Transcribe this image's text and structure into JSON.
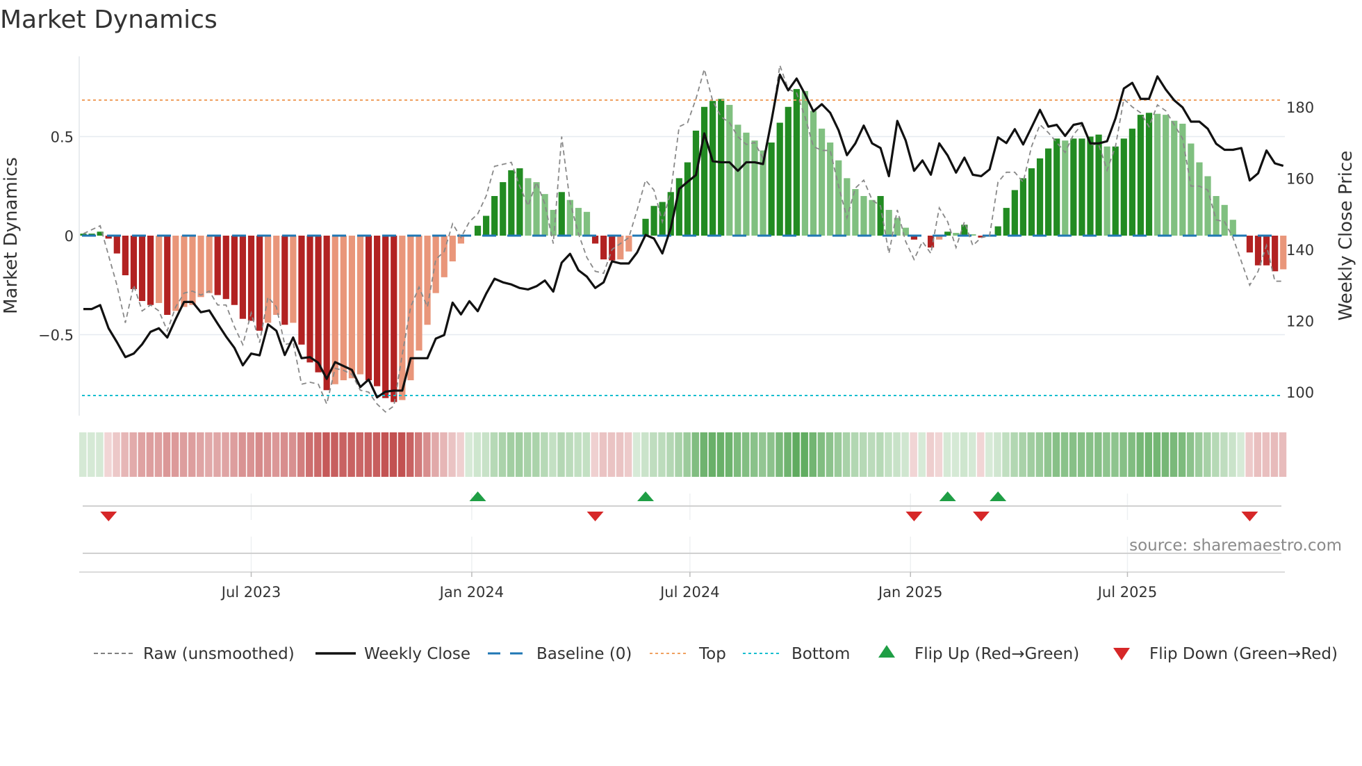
{
  "chart_data": {
    "type": "bar",
    "title": "Market Dynamics",
    "ylabel": "Market Dynamics",
    "ylabel_right": "Weekly Close Price",
    "x_start": "2023-02-11",
    "x_step_days": 7,
    "ylim": [
      -0.9,
      0.9
    ],
    "ylim_right": [
      95,
      192
    ],
    "yticks": [
      {
        "value": 0.5,
        "label": "0.5"
      },
      {
        "value": 0,
        "label": "0"
      },
      {
        "value": -0.5,
        "label": "−0.5"
      }
    ],
    "yticks_right": [
      {
        "value": 180,
        "label": "180"
      },
      {
        "value": 160,
        "label": "160"
      },
      {
        "value": 140,
        "label": "140"
      },
      {
        "value": 120,
        "label": "120"
      },
      {
        "value": 100,
        "label": "100"
      }
    ],
    "xticks": [
      {
        "date": "2023-07-01",
        "label": "Jul 2023"
      },
      {
        "date": "2024-01-01",
        "label": "Jan 2024"
      },
      {
        "date": "2024-07-01",
        "label": "Jul 2024"
      },
      {
        "date": "2025-01-01",
        "label": "Jan 2025"
      },
      {
        "date": "2025-07-01",
        "label": "Jul 2025"
      }
    ],
    "top_level": 0.684,
    "bottom_level": -0.807,
    "baseline": 0,
    "dynamics": [
      0.01,
      0.01,
      0.02,
      -0.015,
      -0.09,
      -0.2,
      -0.27,
      -0.33,
      -0.35,
      -0.34,
      -0.4,
      -0.38,
      -0.36,
      -0.35,
      -0.31,
      -0.29,
      -0.3,
      -0.32,
      -0.35,
      -0.42,
      -0.43,
      -0.48,
      -0.44,
      -0.4,
      -0.45,
      -0.44,
      -0.55,
      -0.64,
      -0.69,
      -0.78,
      -0.75,
      -0.73,
      -0.72,
      -0.7,
      -0.73,
      -0.76,
      -0.82,
      -0.84,
      -0.83,
      -0.73,
      -0.58,
      -0.45,
      -0.29,
      -0.21,
      -0.13,
      -0.04,
      0,
      0.05,
      0.1,
      0.2,
      0.27,
      0.33,
      0.34,
      0.29,
      0.27,
      0.21,
      0.13,
      0.22,
      0.18,
      0.14,
      0.12,
      -0.04,
      -0.12,
      -0.125,
      -0.12,
      -0.08,
      0,
      0.085,
      0.15,
      0.17,
      0.22,
      0.29,
      0.37,
      0.53,
      0.65,
      0.68,
      0.69,
      0.66,
      0.56,
      0.52,
      0.48,
      0.43,
      0.47,
      0.57,
      0.65,
      0.74,
      0.73,
      0.63,
      0.54,
      0.47,
      0.38,
      0.29,
      0.235,
      0.2,
      0.18,
      0.2,
      0.13,
      0.09,
      0.04,
      -0.02,
      0,
      -0.06,
      -0.02,
      0.02,
      0.014,
      0.055,
      0.007,
      -0.01,
      0,
      0.047,
      0.14,
      0.23,
      0.29,
      0.34,
      0.39,
      0.44,
      0.49,
      0.48,
      0.49,
      0.49,
      0.5,
      0.51,
      0.45,
      0.45,
      0.49,
      0.54,
      0.61,
      0.62,
      0.615,
      0.61,
      0.58,
      0.565,
      0.465,
      0.37,
      0.3,
      0.2,
      0.155,
      0.08,
      0,
      -0.085,
      -0.15,
      -0.15,
      -0.18,
      -0.17
    ],
    "raw": [
      0.01,
      0.03,
      0.05,
      -0.1,
      -0.25,
      -0.44,
      -0.25,
      -0.38,
      -0.35,
      -0.38,
      -0.48,
      -0.36,
      -0.29,
      -0.28,
      -0.3,
      -0.28,
      -0.35,
      -0.35,
      -0.46,
      -0.55,
      -0.39,
      -0.54,
      -0.31,
      -0.36,
      -0.55,
      -0.54,
      -0.75,
      -0.74,
      -0.75,
      -0.85,
      -0.67,
      -0.68,
      -0.7,
      -0.78,
      -0.79,
      -0.85,
      -0.89,
      -0.86,
      -0.6,
      -0.36,
      -0.26,
      -0.36,
      -0.12,
      -0.08,
      0.06,
      -0.01,
      0.07,
      0.11,
      0.2,
      0.35,
      0.36,
      0.37,
      0.25,
      0.15,
      0.27,
      0.16,
      -0.04,
      0.5,
      0.17,
      0.01,
      -0.11,
      -0.18,
      -0.19,
      -0.07,
      -0.04,
      -0.01,
      0.13,
      0.28,
      0.23,
      0.07,
      0.22,
      0.55,
      0.57,
      0.69,
      0.84,
      0.68,
      0.6,
      0.57,
      0.5,
      0.46,
      0.47,
      0.39,
      0.57,
      0.86,
      0.74,
      0.72,
      0.6,
      0.45,
      0.43,
      0.43,
      0.25,
      0.09,
      0.24,
      0.28,
      0.18,
      0.15,
      -0.09,
      0.13,
      -0.03,
      -0.12,
      -0.03,
      -0.09,
      0.14,
      0.07,
      -0.06,
      0.07,
      -0.05,
      -0.01,
      0.0,
      0.27,
      0.32,
      0.32,
      0.27,
      0.45,
      0.56,
      0.52,
      0.47,
      0.42,
      0.51,
      0.56,
      0.46,
      0.46,
      0.33,
      0.45,
      0.69,
      0.65,
      0.62,
      0.55,
      0.66,
      0.63,
      0.56,
      0.49,
      0.25,
      0.25,
      0.23,
      0.08,
      0.07,
      -0.01,
      -0.13,
      -0.25,
      -0.18,
      -0.05,
      -0.23,
      -0.23
    ],
    "close": [
      123.3,
      123.3,
      124.4,
      117.9,
      114.0,
      109.8,
      110.8,
      113.4,
      116.9,
      117.9,
      115.3,
      120.5,
      125.3,
      125.3,
      122.4,
      122.9,
      119.2,
      115.6,
      112.4,
      107.5,
      110.8,
      110.3,
      119.0,
      117.2,
      110.4,
      115.3,
      109.5,
      109.8,
      108.2,
      103.7,
      108.4,
      107.3,
      106.2,
      101.4,
      103.5,
      98.5,
      100.1,
      100.4,
      100.4,
      109.5,
      109.5,
      109.5,
      115.0,
      116.0,
      125.1,
      121.8,
      125.5,
      122.7,
      127.6,
      131.8,
      130.8,
      130.2,
      129.2,
      128.8,
      129.7,
      131.3,
      128.2,
      136.3,
      138.8,
      134.2,
      132.4,
      129.2,
      130.8,
      136.7,
      136.1,
      136.1,
      139.2,
      144.1,
      143.1,
      138.9,
      146.0,
      157.0,
      159.0,
      160.9,
      172.6,
      164.8,
      164.5,
      164.5,
      162.1,
      164.5,
      164.5,
      164.0,
      176.1,
      189.1,
      184.7,
      188.0,
      183.6,
      178.8,
      180.8,
      178.4,
      173.5,
      166.5,
      169.8,
      174.8,
      169.8,
      168.5,
      160.6,
      176.1,
      170.6,
      162.1,
      165.0,
      161.0,
      169.8,
      166.4,
      161.6,
      165.8,
      161.0,
      160.6,
      162.5,
      171.5,
      169.9,
      173.8,
      169.5,
      174.3,
      179.2,
      174.5,
      175.0,
      171.9,
      175.0,
      175.5,
      169.8,
      169.8,
      170.4,
      176.8,
      185.2,
      186.8,
      182.3,
      182.3,
      188.6,
      184.9,
      181.9,
      179.9,
      175.9,
      175.9,
      173.9,
      169.7,
      168.0,
      168.0,
      168.5,
      159.4,
      161.4,
      167.8,
      164.2,
      163.5
    ],
    "flip_up_weeks": [
      47,
      67,
      103,
      109
    ],
    "flip_down_weeks": [
      3,
      61,
      99,
      107,
      139
    ],
    "legend": [
      {
        "label": "Raw (unsmoothed)",
        "style": "dashed",
        "color": "#808080"
      },
      {
        "label": "Weekly Close",
        "style": "solid",
        "color": "#111111"
      },
      {
        "label": "Baseline (0)",
        "style": "dashed",
        "color": "#1f77b4"
      },
      {
        "label": "Top",
        "style": "dotted",
        "color": "#f0a060"
      },
      {
        "label": "Bottom",
        "style": "dotted",
        "color": "#17becf"
      },
      {
        "label": "Flip Up (Red→Green)",
        "style": "triangle-up",
        "color": "#1f9e45"
      },
      {
        "label": "Flip Down (Green→Red)",
        "style": "triangle-down",
        "color": "#d62728"
      }
    ],
    "legend_position": "bottom",
    "colors": {
      "rise_green": "#228b22",
      "fall_green": "#80c080",
      "fall_red": "#b22222",
      "rise_red": "#e9967a",
      "grid": "#e6eaf0"
    },
    "source": "source: sharemaestro.com"
  }
}
